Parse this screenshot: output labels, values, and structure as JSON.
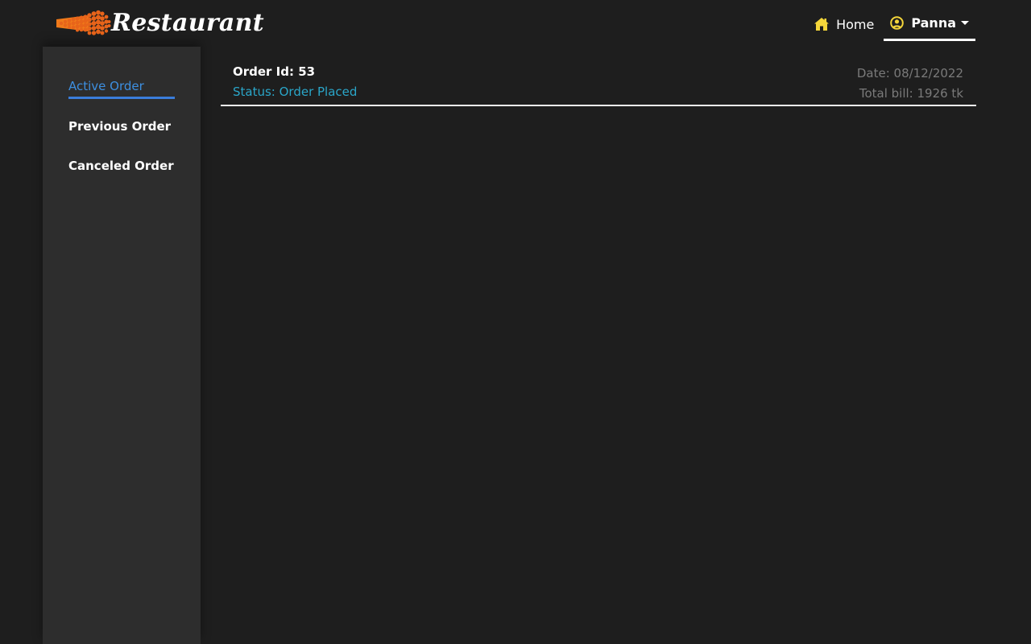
{
  "header": {
    "brand": "Restaurant",
    "home_label": "Home",
    "user_label": "Panna"
  },
  "sidebar": {
    "items": [
      {
        "label": "Active Order",
        "active": true
      },
      {
        "label": "Previous Order",
        "active": false
      },
      {
        "label": "Canceled Order",
        "active": false
      }
    ]
  },
  "order": {
    "id_text": "Order Id: 53",
    "status_text": "Status: Order Placed",
    "date_text": "Date: 08/12/2022",
    "bill_text": "Total bill: 1926 tk"
  },
  "icons": {
    "home": "home-icon",
    "user": "user-circle-icon",
    "dropdown": "caret-down-icon",
    "logo": "restaurant-logo"
  },
  "colors": {
    "background": "#1e1e1e",
    "sidebar": "#2d2d2d",
    "accent_blue": "#3d8fe0",
    "status_teal": "#2aa6c9",
    "icon_yellow": "#f5d63a",
    "logo_orange": "#f07a1a",
    "muted_text": "#7a7a7a"
  }
}
